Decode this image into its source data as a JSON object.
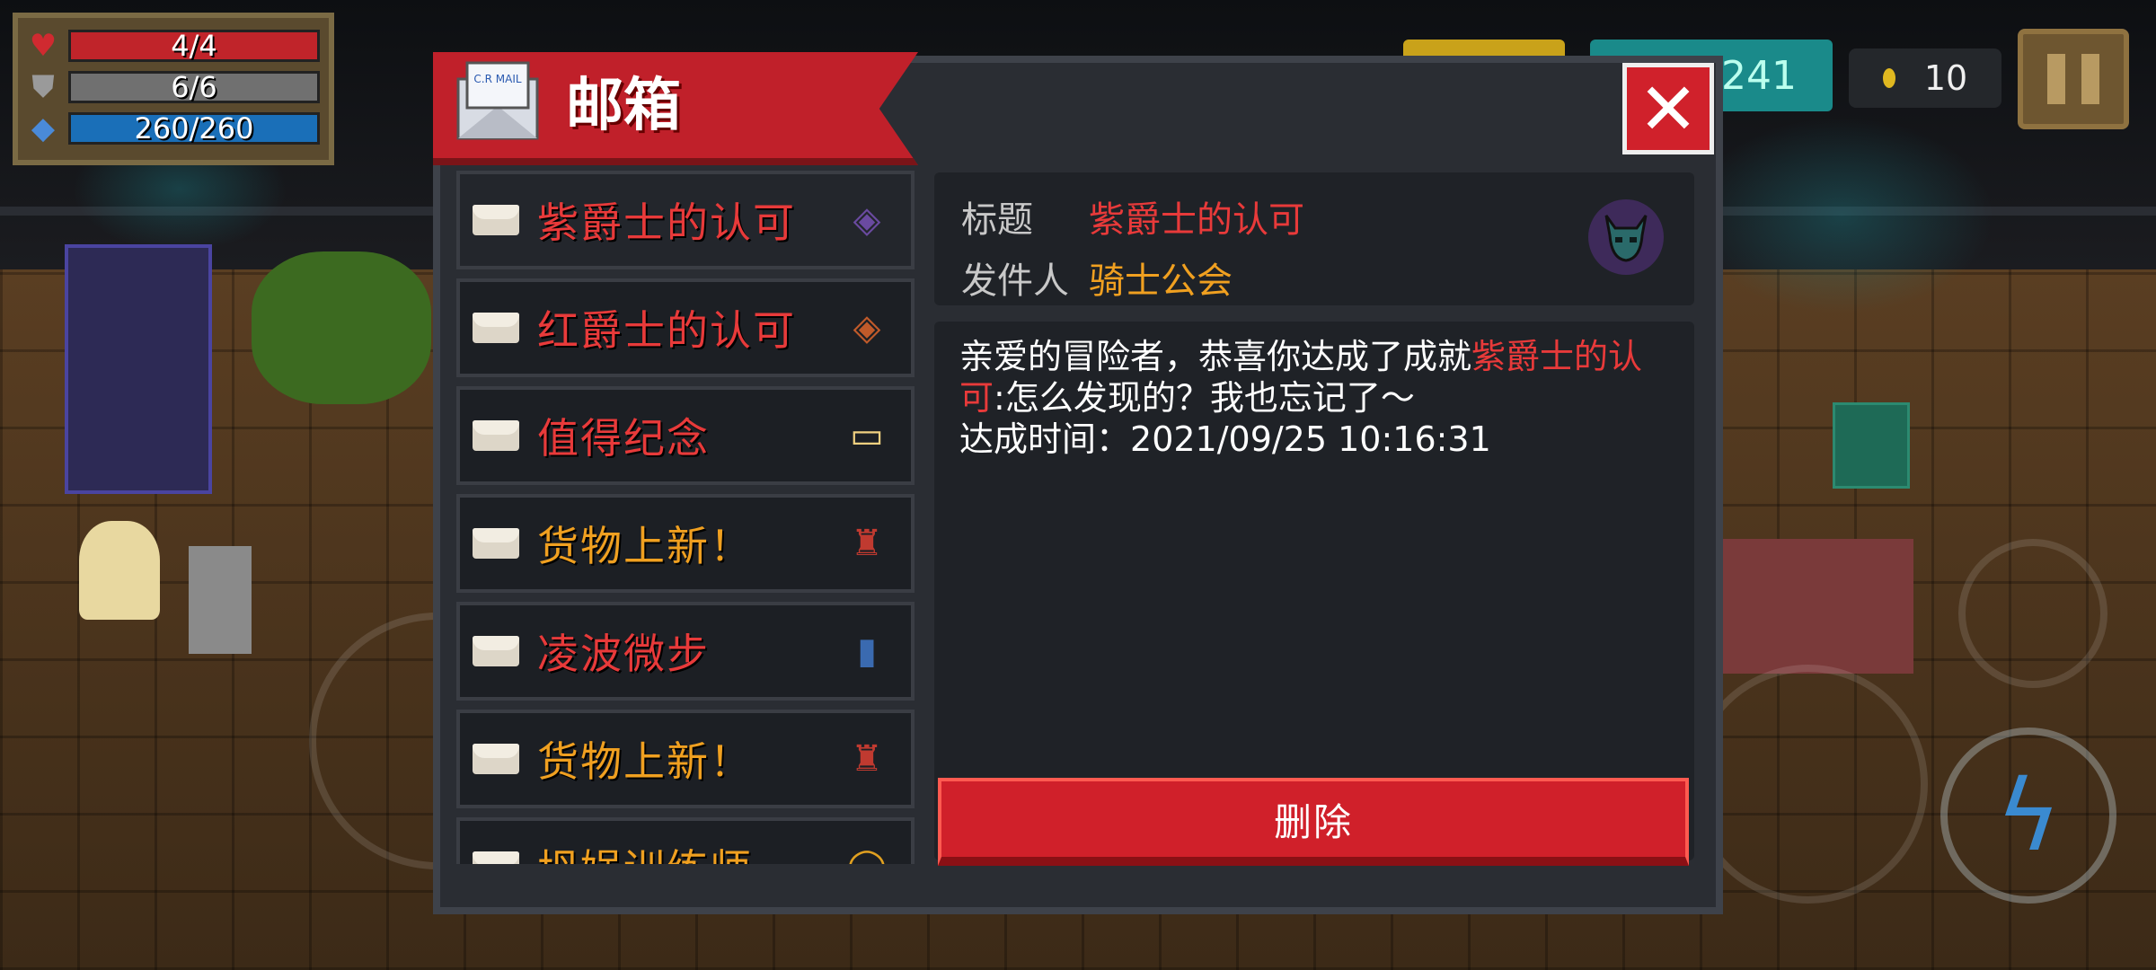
{
  "hud": {
    "hp": {
      "text": "4/4",
      "fill": 1.0
    },
    "armor": {
      "text": "6/6",
      "fill": 1.0
    },
    "energy": {
      "text": "260/260",
      "fill": 1.0
    },
    "gems": "241",
    "coins": "10"
  },
  "dialog": {
    "title": "邮箱",
    "icon_text": "C.R MAIL",
    "close_icon": "close-icon",
    "mails": [
      {
        "label": "紫爵士的认可",
        "color": "#e83a3a",
        "thumb": "purple-knight-helmet-icon",
        "selected": true
      },
      {
        "label": "红爵士的认可",
        "color": "#e83a3a",
        "thumb": "red-knight-helmet-icon"
      },
      {
        "label": "值得纪念",
        "color": "#e83a3a",
        "thumb": "monitor-icon"
      },
      {
        "label": "货物上新！",
        "color": "#f0a020",
        "thumb": "merchant-icon"
      },
      {
        "label": "凌波微步",
        "color": "#e83a3a",
        "thumb": "book-icon"
      },
      {
        "label": "货物上新！",
        "color": "#f0a020",
        "thumb": "merchant-icon"
      },
      {
        "label": "坍娲训练师",
        "color": "#f0a020",
        "thumb": "halo-icon"
      }
    ],
    "detail": {
      "subject_label": "标题",
      "subject": "紫爵士的认可",
      "sender_label": "发件人",
      "sender": "骑士公会",
      "body_prefix": "亲爱的冒险者，恭喜你达成了成就",
      "body_highlight": "紫爵士的认可",
      "body_suffix": ":怎么发现的？我也忘记了～",
      "time_label": "达成时间：",
      "time_value": "2021/09/25 10:16:31"
    },
    "delete_label": "删除"
  },
  "colors": {
    "hp": "#c0242a",
    "armor": "#707070",
    "energy": "#1a6fb8",
    "red_text": "#e83a3a",
    "orange_text": "#f0a020"
  }
}
